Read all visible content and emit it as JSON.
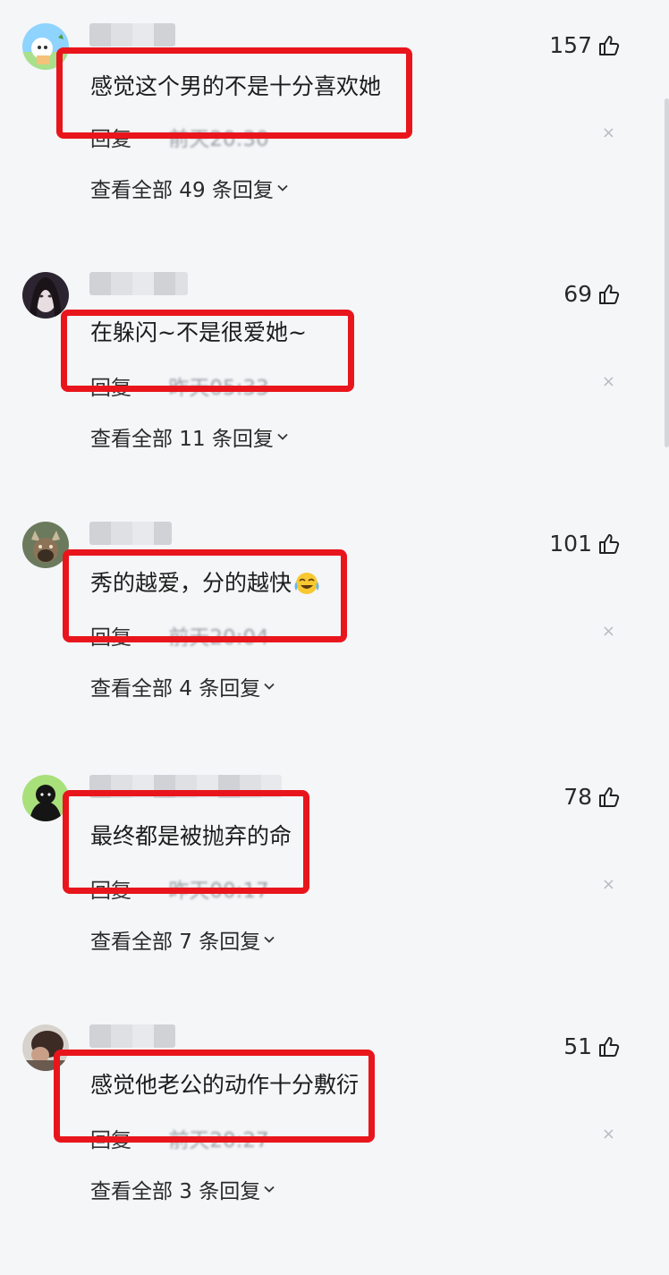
{
  "comments": [
    {
      "likes": "157",
      "text": "感觉这个男的不是十分喜欢她",
      "reply_label": "回复",
      "time": "前天20:30",
      "view_replies": "查看全部 49 条回复"
    },
    {
      "likes": "69",
      "text": "在躲闪~不是很爱她~",
      "reply_label": "回复",
      "time": "昨天05:33",
      "view_replies": "查看全部 11 条回复"
    },
    {
      "likes": "101",
      "text": "秀的越爱，分的越快",
      "emoji": "crying-laughing-emoji",
      "reply_label": "回复",
      "time": "前天20:04",
      "view_replies": "查看全部 4 条回复"
    },
    {
      "likes": "78",
      "text": "最终都是被抛弃的命",
      "reply_label": "回复",
      "time": "昨天00:17",
      "view_replies": "查看全部 7 条回复"
    },
    {
      "likes": "51",
      "text": "感觉他老公的动作十分敷衍",
      "reply_label": "回复",
      "time": "前天20:27",
      "view_replies": "查看全部 3 条回复"
    }
  ],
  "icons": {
    "like": "thumbs-up-icon",
    "close": "close-icon",
    "expand": "chevron-down-icon"
  },
  "close_glyph": "×",
  "colors": {
    "highlight_box": "#e8161c",
    "background": "#f5f6f8",
    "time_text": "#9aa0a6"
  }
}
